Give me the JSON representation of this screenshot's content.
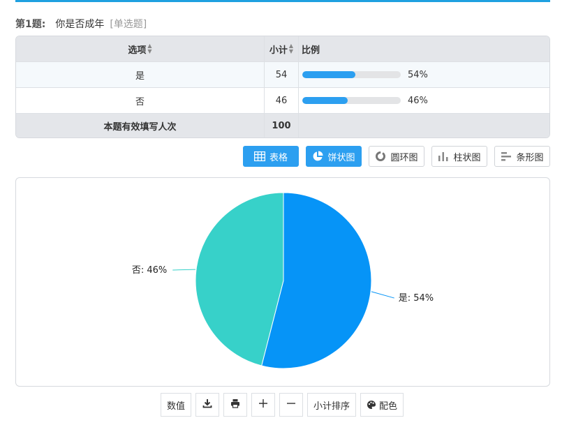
{
  "question": {
    "number": "第1题:",
    "text": "你是否成年",
    "type": "[单选题]"
  },
  "table": {
    "headers": {
      "option": "选项",
      "count": "小计",
      "ratio": "比例"
    },
    "rows": [
      {
        "option": "是",
        "count": "54",
        "percent": "54%",
        "fraction": 0.54
      },
      {
        "option": "否",
        "count": "46",
        "percent": "46%",
        "fraction": 0.46
      }
    ],
    "footer": {
      "label": "本题有效填写人次",
      "total": "100"
    }
  },
  "view_buttons": [
    {
      "label": "表格",
      "icon": "table-icon",
      "active": true
    },
    {
      "label": "饼状图",
      "icon": "pie-chart-icon",
      "active": true
    },
    {
      "label": "圆环图",
      "icon": "donut-chart-icon",
      "active": false
    },
    {
      "label": "柱状图",
      "icon": "bar-chart-icon",
      "active": false
    },
    {
      "label": "条形图",
      "icon": "horizontal-bar-chart-icon",
      "active": false
    }
  ],
  "toolbar": {
    "values_label": "数值",
    "sort_label": "小计排序",
    "color_label": "配色",
    "icons": [
      "download-icon",
      "print-icon",
      "plus-icon",
      "minus-icon",
      "palette-icon"
    ]
  },
  "colors": {
    "accent": "#2c9ff0",
    "rule": "#1fa0e0",
    "slice_yes": "#0694f7",
    "slice_no": "#37d1c9"
  },
  "chart_data": {
    "type": "pie",
    "categories": [
      "是",
      "否"
    ],
    "values": [
      54,
      46
    ],
    "labels": [
      "是: 54%",
      "否: 46%"
    ],
    "colors": [
      "#0694f7",
      "#37d1c9"
    ],
    "start": "top",
    "direction": "clockwise"
  }
}
